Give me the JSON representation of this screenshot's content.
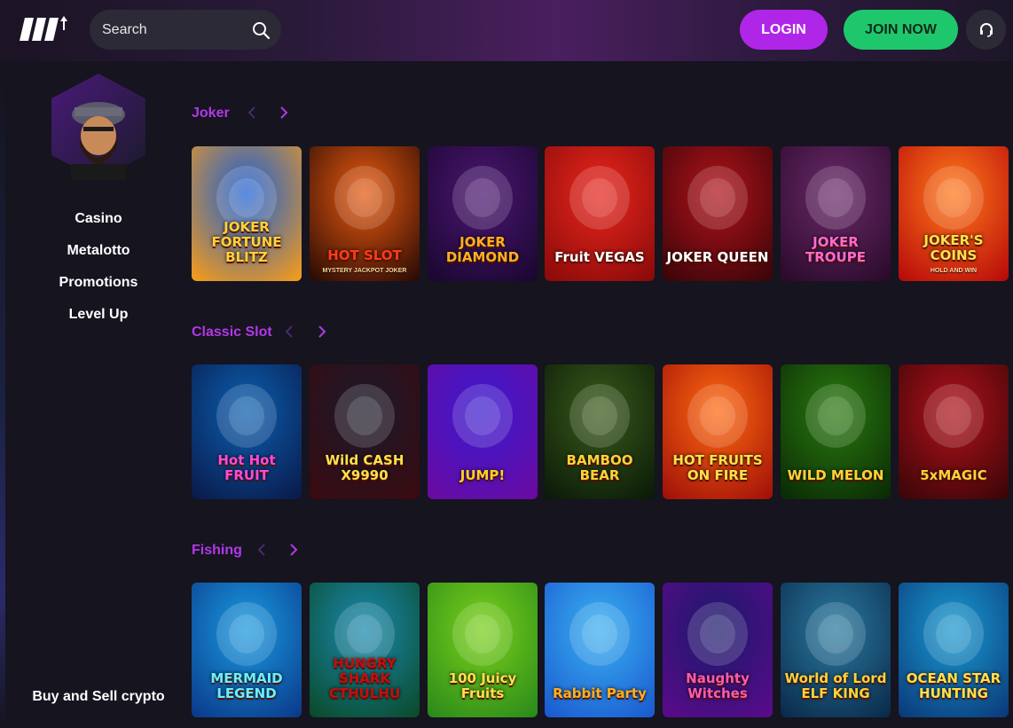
{
  "header": {
    "search_placeholder": "Search",
    "login_label": "LOGIN",
    "join_label": "JOIN NOW"
  },
  "sidebar": {
    "nav": [
      "Casino",
      "Metalotto",
      "Promotions",
      "Level Up"
    ],
    "footer_link": "Buy and Sell crypto"
  },
  "colors": {
    "accent_purple": "#b026e8",
    "join_green": "#1fc76c",
    "section_title": "#b338e8"
  },
  "sections": [
    {
      "title": "Joker",
      "games": [
        {
          "label": "JOKER FORTUNE BLITZ",
          "sub": "",
          "bg": [
            "#1a5fd6",
            "#f59b1a"
          ],
          "label_color": "#ffd23a"
        },
        {
          "label": "HOT SLOT",
          "sub": "MYSTERY JACKPOT JOKER",
          "bg": [
            "#e85a10",
            "#2a0a04"
          ],
          "label_color": "#ff3b1a"
        },
        {
          "label": "JOKER DIAMOND",
          "sub": "",
          "bg": [
            "#4a1570",
            "#1a0730"
          ],
          "label_color": "#ffb020"
        },
        {
          "label": "Fruit VEGAS",
          "sub": "",
          "bg": [
            "#e8261c",
            "#8a0a0a"
          ],
          "label_color": "#ffffff"
        },
        {
          "label": "JOKER QUEEN",
          "sub": "",
          "bg": [
            "#b0121a",
            "#3a0509"
          ],
          "label_color": "#ffffff"
        },
        {
          "label": "JOKER TROUPE",
          "sub": "",
          "bg": [
            "#6a2a6a",
            "#2a0a2a"
          ],
          "label_color": "#ff6ad0"
        },
        {
          "label": "JOKER'S COINS",
          "sub": "HOLD AND WIN",
          "bg": [
            "#ff7a1a",
            "#b80a0a"
          ],
          "label_color": "#ffe04a"
        }
      ]
    },
    {
      "title": "Classic Slot",
      "games": [
        {
          "label": "Hot Hot FRUIT",
          "sub": "",
          "bg": [
            "#0b5fb0",
            "#0a1a4a"
          ],
          "label_color": "#ff4ad8"
        },
        {
          "label": "Wild CASH X9990",
          "sub": "",
          "bg": [
            "#1a1a2a",
            "#3a0a10"
          ],
          "label_color": "#ffe04a"
        },
        {
          "label": "JUMP!",
          "sub": "",
          "bg": [
            "#3a1ad0",
            "#6a0aa0"
          ],
          "label_color": "#ffd020"
        },
        {
          "label": "BAMBOO BEAR",
          "sub": "",
          "bg": [
            "#3a5a1a",
            "#0a1a08"
          ],
          "label_color": "#ffd23a"
        },
        {
          "label": "HOT FRUITS ON FIRE",
          "sub": "",
          "bg": [
            "#ff6a10",
            "#a01008"
          ],
          "label_color": "#ffe04a"
        },
        {
          "label": "WILD MELON",
          "sub": "",
          "bg": [
            "#2a7a10",
            "#0a2a04"
          ],
          "label_color": "#ffd23a"
        },
        {
          "label": "5xMAGIC",
          "sub": "",
          "bg": [
            "#b0121a",
            "#3a0508"
          ],
          "label_color": "#ffd23a"
        }
      ]
    },
    {
      "title": "Fishing",
      "games": [
        {
          "label": "MERMAID LEGEND",
          "sub": "",
          "bg": [
            "#1a9ae0",
            "#0a3a8a"
          ],
          "label_color": "#6af0ff"
        },
        {
          "label": "HUNGRY SHARK CTHULHU",
          "sub": "",
          "bg": [
            "#1a8ab0",
            "#0a4a2a"
          ],
          "label_color": "#c01010"
        },
        {
          "label": "100 Juicy Fruits",
          "sub": "",
          "bg": [
            "#7ad01a",
            "#2a8a1a"
          ],
          "label_color": "#ffe04a"
        },
        {
          "label": "Rabbit Party",
          "sub": "",
          "bg": [
            "#3ab0f0",
            "#1a5ad0"
          ],
          "label_color": "#ffb020"
        },
        {
          "label": "Naughty Witches",
          "sub": "",
          "bg": [
            "#1a1a6a",
            "#5a0a8a"
          ],
          "label_color": "#ff5ab0"
        },
        {
          "label": "World of Lord ELF KING",
          "sub": "",
          "bg": [
            "#2a7aa0",
            "#0a2a4a"
          ],
          "label_color": "#ffd23a"
        },
        {
          "label": "OCEAN STAR HUNTING",
          "sub": "",
          "bg": [
            "#1a9ad0",
            "#0a3a7a"
          ],
          "label_color": "#ffe04a"
        }
      ]
    }
  ]
}
